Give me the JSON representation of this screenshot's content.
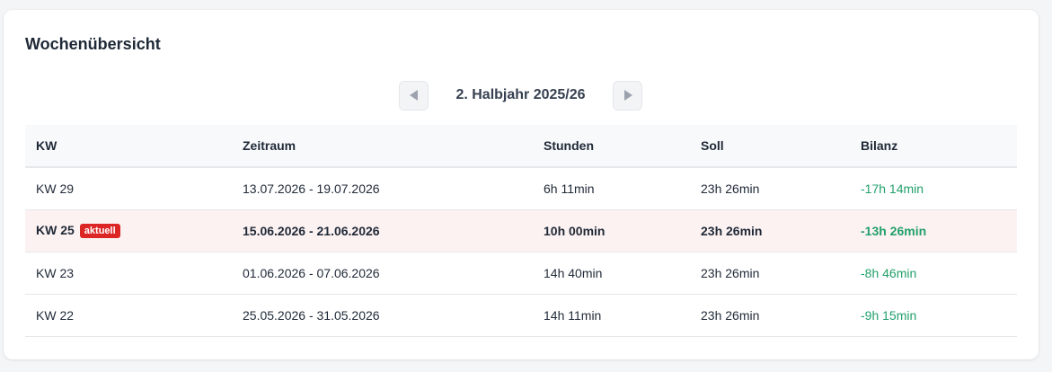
{
  "title": "Wochenübersicht",
  "nav": {
    "prev_icon": "triangle-left-icon",
    "next_icon": "triangle-right-icon",
    "period_label": "2. Halbjahr 2025/26"
  },
  "table": {
    "headers": [
      "KW",
      "Zeitraum",
      "Stunden",
      "Soll",
      "Bilanz"
    ],
    "rows": [
      {
        "kw": "KW 29",
        "zeitraum": "13.07.2026 - 19.07.2026",
        "stunden": "6h 11min",
        "soll": "23h 26min",
        "bilanz": "-17h 14min",
        "current": false
      },
      {
        "kw": "KW 25",
        "badge": "aktuell",
        "zeitraum": "15.06.2026 - 21.06.2026",
        "stunden": "10h 00min",
        "soll": "23h 26min",
        "bilanz": "-13h 26min",
        "current": true
      },
      {
        "kw": "KW 23",
        "zeitraum": "01.06.2026 - 07.06.2026",
        "stunden": "14h 40min",
        "soll": "23h 26min",
        "bilanz": "-8h 46min",
        "current": false
      },
      {
        "kw": "KW 22",
        "zeitraum": "25.05.2026 - 31.05.2026",
        "stunden": "14h 11min",
        "soll": "23h 26min",
        "bilanz": "-9h 15min",
        "current": false
      }
    ]
  },
  "colors": {
    "accent_green": "#22a06b",
    "badge_red": "#dc2626",
    "current_row_bg": "#fdf2f2"
  }
}
